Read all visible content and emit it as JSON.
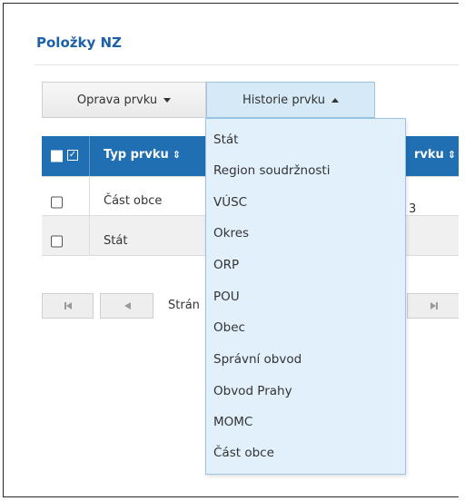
{
  "panel": {
    "title": "Položky NZ"
  },
  "toolbar": {
    "edit_label": "Oprava prvku",
    "history_label": "Historie prvku"
  },
  "table": {
    "columns": [
      "Typ prvku",
      "rvku"
    ],
    "sort_glyph": "⇕",
    "rows": [
      {
        "type": "Část obce",
        "tail": "3"
      },
      {
        "type": "Stát",
        "tail": ""
      }
    ]
  },
  "pager": {
    "label": "Strán"
  },
  "history_menu": {
    "items": [
      "Stát",
      "Region soudržnosti",
      "VÚSC",
      "Okres",
      "ORP",
      "POU",
      "Obec",
      "Správní obvod",
      "Obvod Prahy",
      "MOMC",
      "Část obce"
    ]
  },
  "colors": {
    "accent": "#1f6fb2",
    "title": "#1d62a8",
    "menu_bg": "#e2f0fb",
    "active_button": "#d6e9f7"
  },
  "icons": {
    "edit_caret": "caret-down-icon",
    "history_caret": "caret-up-icon",
    "sort": "sort-icon",
    "pager_first": "first-page-icon",
    "pager_prev": "prev-page-icon",
    "pager_last": "last-page-icon"
  }
}
